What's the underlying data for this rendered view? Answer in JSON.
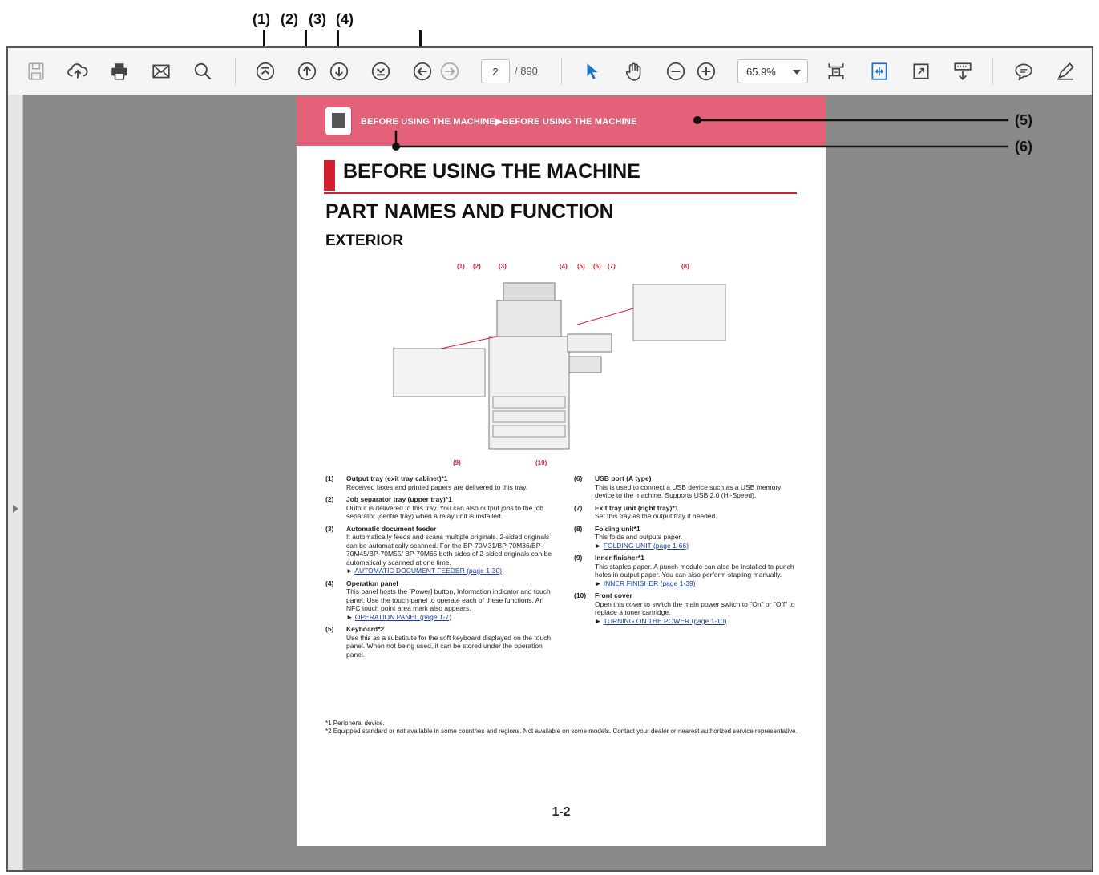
{
  "callouts": {
    "c1": "(1)",
    "c2": "(2)",
    "c3": "(3)",
    "c4": "(4)",
    "c5": "(5)",
    "c6": "(6)"
  },
  "toolbar": {
    "page_current": "2",
    "page_total": "/ 890",
    "zoom": "65.9%"
  },
  "page": {
    "breadcrumb": "BEFORE USING THE MACHINE▶BEFORE USING THE MACHINE",
    "h1": "BEFORE USING THE MACHINE",
    "h2": "PART NAMES AND FUNCTION",
    "h3": "EXTERIOR",
    "illustration_labels": [
      "(1)",
      "(2)",
      "(3)",
      "(4)",
      "(5)",
      "(6)",
      "(7)",
      "(8)",
      "(9)",
      "(10)"
    ],
    "items_left": [
      {
        "num": "(1)",
        "title": "Output tray (exit tray cabinet)*1",
        "desc": "Received faxes and printed papers are delivered to this tray.",
        "link": ""
      },
      {
        "num": "(2)",
        "title": "Job separator tray (upper tray)*1",
        "desc": "Output is delivered to this tray. You can also output jobs to the job separator (centre tray) when a relay unit is installed.",
        "link": ""
      },
      {
        "num": "(3)",
        "title": "Automatic document feeder",
        "desc": "It automatically feeds and scans multiple originals. 2-sided originals can be automatically scanned. For the BP-70M31/BP-70M36/BP-70M45/BP-70M55/ BP-70M65 both sides of 2-sided originals can be automatically scanned at one time.",
        "link": "AUTOMATIC DOCUMENT FEEDER (page 1-30)"
      },
      {
        "num": "(4)",
        "title": "Operation panel",
        "desc": "This panel hosts the [Power] button, Information indicator and touch panel. Use the touch panel to operate each of these functions. An NFC touch point area mark also appears.",
        "link": "OPERATION PANEL (page 1-7)"
      },
      {
        "num": "(5)",
        "title": "Keyboard*2",
        "desc": "Use this as a substitute for the soft keyboard displayed on the touch panel. When not being used, it can be stored under the operation panel.",
        "link": ""
      }
    ],
    "items_right": [
      {
        "num": "(6)",
        "title": "USB port (A type)",
        "desc": "This is used to connect a USB device such as a USB memory device to the machine. Supports USB 2.0 (Hi-Speed).",
        "link": ""
      },
      {
        "num": "(7)",
        "title": "Exit tray unit (right tray)*1",
        "desc": "Set this tray as the output tray if needed.",
        "link": ""
      },
      {
        "num": "(8)",
        "title": "Folding unit*1",
        "desc": "This folds and outputs paper.",
        "link": "FOLDING UNIT (page 1-66)"
      },
      {
        "num": "(9)",
        "title": "Inner finisher*1",
        "desc": "This staples paper. A punch module can also be installed to punch holes in output paper. You can also perform stapling manually.",
        "link": "INNER FINISHER (page 1-39)"
      },
      {
        "num": "(10)",
        "title": "Front cover",
        "desc": "Open this cover to switch the main power switch to \"On\" or \"Off\" to replace a toner cartridge.",
        "link": "TURNING ON THE POWER (page 1-10)"
      }
    ],
    "footnote1": "*1   Peripheral device.",
    "footnote2": "*2   Equipped standard or not available in some countries and regions. Not available on some models. Contact your dealer or nearest authorized service representative.",
    "page_number": "1-2"
  }
}
